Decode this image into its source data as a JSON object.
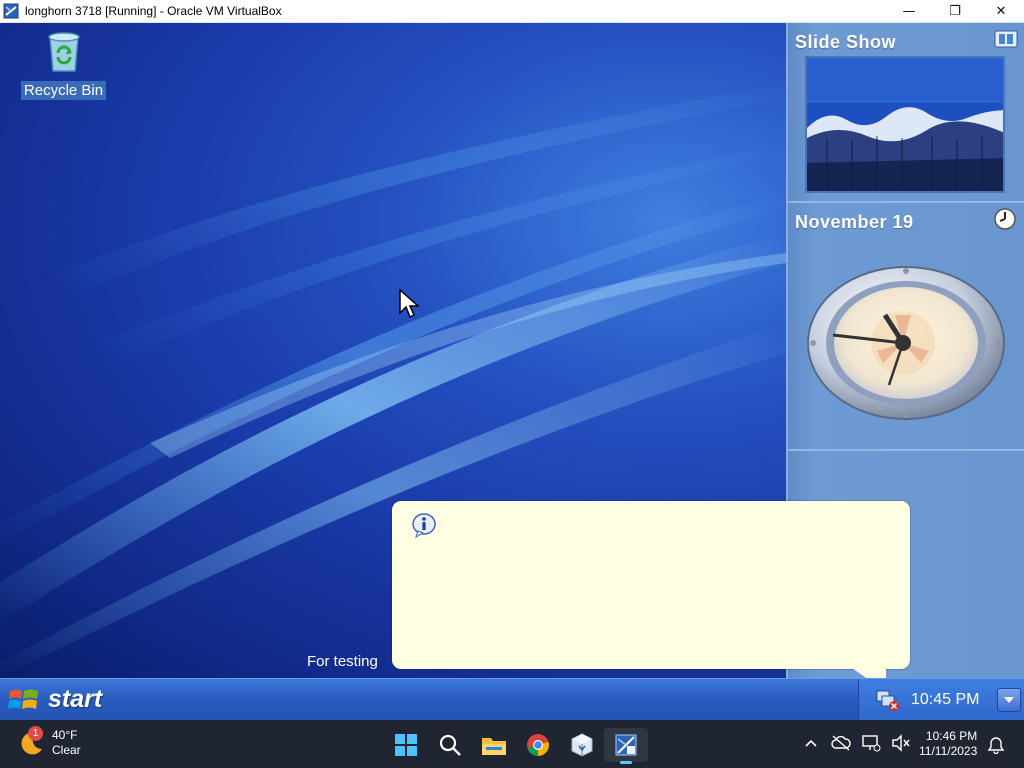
{
  "host_window": {
    "title": "longhorn 3718 [Running] - Oracle VM VirtualBox",
    "minimize_glyph": "—",
    "restore_glyph": "❐",
    "close_glyph": "✕"
  },
  "desktop": {
    "icons": [
      {
        "label": "Recycle Bin",
        "icon": "recycle-bin-icon"
      }
    ],
    "watermark_text": "For testing"
  },
  "sidebar": {
    "slideshow": {
      "title": "Slide Show"
    },
    "clock": {
      "title": "November 19",
      "time_shown": "10:45"
    }
  },
  "balloon": {
    "icon": "info-icon",
    "text": ""
  },
  "guest_taskbar": {
    "start_label": "start",
    "tray_time": "10:45 PM"
  },
  "host_taskbar": {
    "weather": {
      "temp": "40°F",
      "condition": "Clear",
      "badge": "1"
    },
    "apps": [
      "windows-start-icon",
      "search-icon",
      "file-explorer-icon",
      "chrome-icon",
      "virtualbox-icon",
      "longhorn-vm-icon"
    ],
    "clock": {
      "time": "10:46 PM",
      "date": "11/11/2023"
    }
  },
  "colors": {
    "guest_taskbar": "#2a5bc0",
    "sidebar": "#6a96cf",
    "balloon": "#ffffe1",
    "host_taskbar": "#1f2632"
  }
}
